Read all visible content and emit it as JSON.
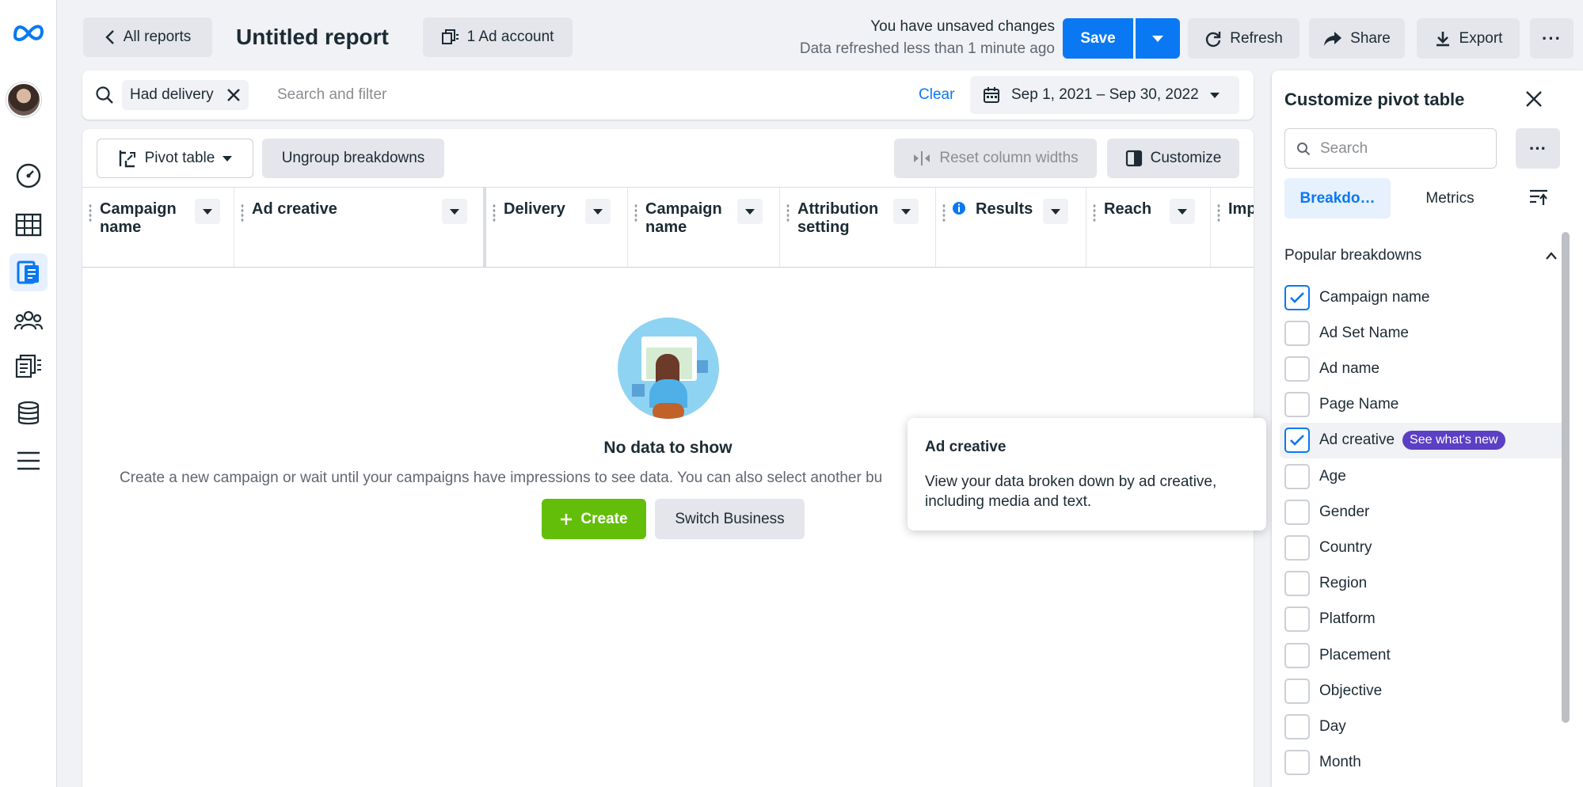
{
  "topbar": {
    "back_label": "All reports",
    "report_title": "Untitled report",
    "ad_account_label": "1 Ad account",
    "unsaved_text": "You have unsaved changes",
    "refreshed_text": "Data refreshed less than 1 minute ago",
    "save_label": "Save",
    "refresh_label": "Refresh",
    "share_label": "Share",
    "export_label": "Export"
  },
  "filterbar": {
    "chip_label": "Had delivery",
    "search_placeholder": "Search and filter",
    "clear_label": "Clear",
    "date_range": "Sep 1, 2021 – Sep 30, 2022"
  },
  "toolbar": {
    "pivot_label": "Pivot table",
    "ungroup_label": "Ungroup breakdowns",
    "reset_label": "Reset column widths",
    "customize_label": "Customize"
  },
  "table": {
    "columns": [
      {
        "line1": "Campaign",
        "line2": "name"
      },
      {
        "line1": "Ad creative",
        "line2": ""
      },
      {
        "line1": "Delivery",
        "line2": ""
      },
      {
        "line1": "Campaign",
        "line2": "name"
      },
      {
        "line1": "Attribution",
        "line2": "setting"
      },
      {
        "line1": "Results",
        "line2": ""
      },
      {
        "line1": "Reach",
        "line2": ""
      },
      {
        "line1": "Imp",
        "line2": ""
      }
    ]
  },
  "empty": {
    "title": "No data to show",
    "message": "Create a new campaign or wait until your campaigns have impressions to see data. You can also select another bu",
    "create_label": "Create",
    "switch_label": "Switch Business"
  },
  "tooltip": {
    "title": "Ad creative",
    "body": "View your data broken down by ad creative, including media and text."
  },
  "panel": {
    "title": "Customize pivot table",
    "search_placeholder": "Search",
    "tab_breakdowns": "Breakdo…",
    "tab_metrics": "Metrics",
    "section_title": "Popular breakdowns",
    "badge_label": "See what's new",
    "items": [
      {
        "label": "Campaign name",
        "checked": true
      },
      {
        "label": "Ad Set Name",
        "checked": false
      },
      {
        "label": "Ad name",
        "checked": false
      },
      {
        "label": "Page Name",
        "checked": false
      },
      {
        "label": "Ad creative",
        "checked": true
      },
      {
        "label": "Age",
        "checked": false
      },
      {
        "label": "Gender",
        "checked": false
      },
      {
        "label": "Country",
        "checked": false
      },
      {
        "label": "Region",
        "checked": false
      },
      {
        "label": "Platform",
        "checked": false
      },
      {
        "label": "Placement",
        "checked": false
      },
      {
        "label": "Objective",
        "checked": false
      },
      {
        "label": "Day",
        "checked": false
      },
      {
        "label": "Month",
        "checked": false
      }
    ]
  },
  "colors": {
    "accent": "#0a78f2",
    "create_green": "#63be09",
    "badge_purple": "#5b3fc4"
  }
}
